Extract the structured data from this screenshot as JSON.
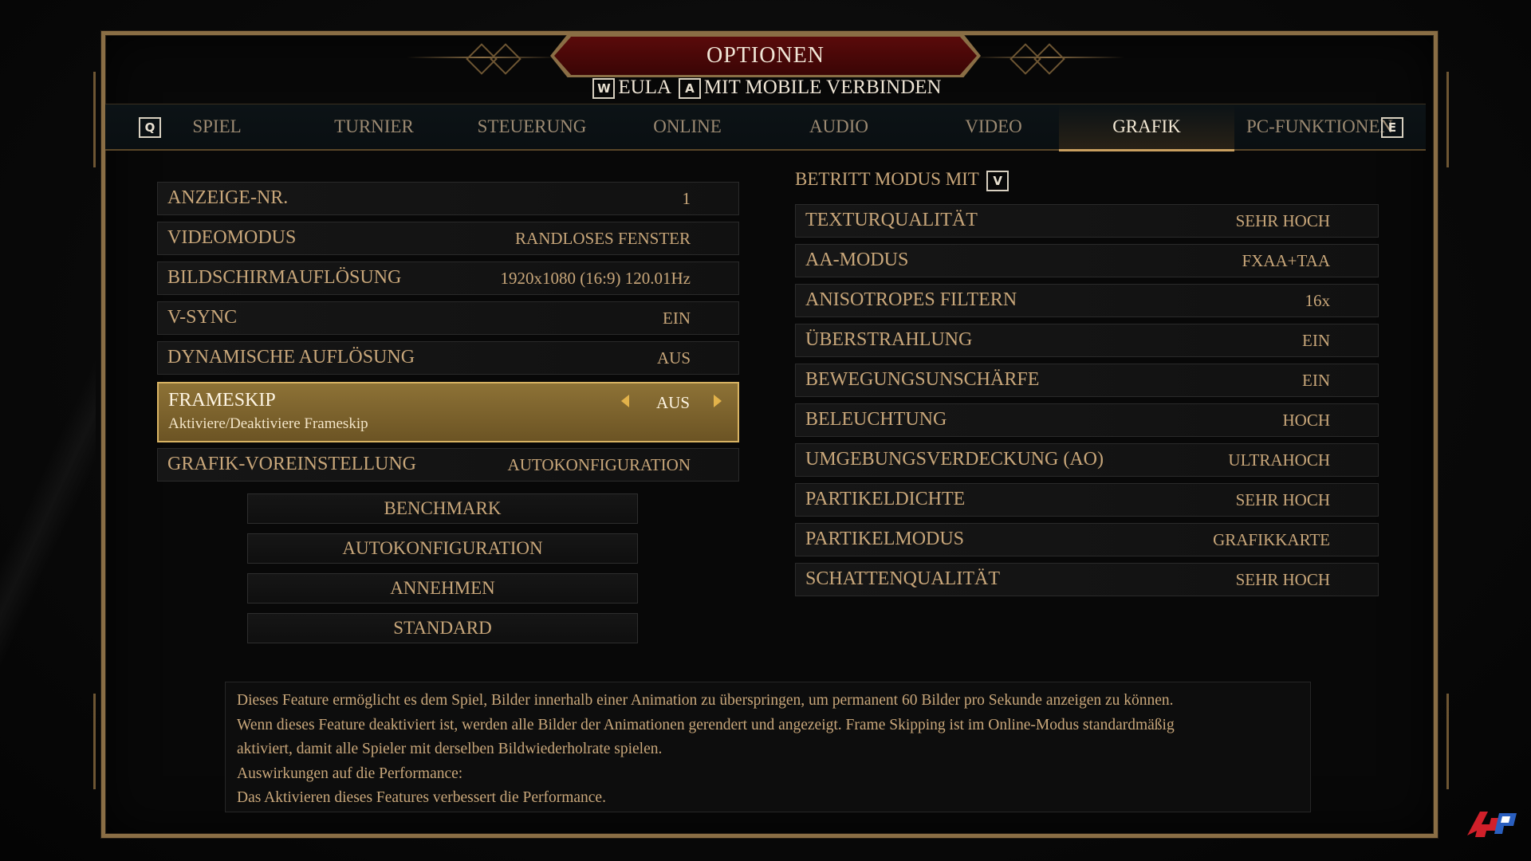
{
  "title": "OPTIONEN",
  "subheader": {
    "eula_key": "W",
    "eula_label": "EULA",
    "mobile_key": "A",
    "mobile_label": "MIT MOBILE VERBINDEN"
  },
  "tabs": {
    "prev_key": "Q",
    "next_key": "E",
    "items": [
      "SPIEL",
      "TURNIER",
      "STEUERUNG",
      "ONLINE",
      "AUDIO",
      "VIDEO",
      "GRAFIK",
      "PC-FUNKTIONEN"
    ],
    "active": "GRAFIK"
  },
  "left_settings": [
    {
      "label": "ANZEIGE-NR.",
      "value": "1"
    },
    {
      "label": "VIDEOMODUS",
      "value": "RANDLOSES FENSTER"
    },
    {
      "label": "BILDSCHIRMAUFLÖSUNG",
      "value": "1920x1080 (16:9) 120.01Hz"
    },
    {
      "label": "V-SYNC",
      "value": "EIN"
    },
    {
      "label": "DYNAMISCHE AUFLÖSUNG",
      "value": "AUS"
    },
    {
      "label": "FRAMESKIP",
      "value": "AUS",
      "description": "Aktiviere/Deaktiviere Frameskip"
    },
    {
      "label": "GRAFIK-VOREINSTELLUNG",
      "value": "AUTOKONFIGURATION"
    }
  ],
  "buttons": [
    "BENCHMARK",
    "AUTOKONFIGURATION",
    "ANNEHMEN",
    "STANDARD"
  ],
  "right_panel": {
    "enter_mode_label": "BETRITT MODUS MIT",
    "enter_mode_key": "V",
    "settings": [
      {
        "label": "TEXTURQUALITÄT",
        "value": "SEHR HOCH"
      },
      {
        "label": "AA-MODUS",
        "value": "FXAA+TAA"
      },
      {
        "label": "ANISOTROPES FILTERN",
        "value": "16x"
      },
      {
        "label": "ÜBERSTRAHLUNG",
        "value": "EIN"
      },
      {
        "label": "BEWEGUNGSUNSCHÄRFE",
        "value": "EIN"
      },
      {
        "label": "BELEUCHTUNG",
        "value": "HOCH"
      },
      {
        "label": "UMGEBUNGSVERDECKUNG (AO)",
        "value": "ULTRAHOCH"
      },
      {
        "label": "PARTIKELDICHTE",
        "value": "SEHR HOCH"
      },
      {
        "label": "PARTIKELMODUS",
        "value": "GRAFIKKARTE"
      },
      {
        "label": "SCHATTENQUALITÄT",
        "value": "SEHR HOCH"
      }
    ]
  },
  "description_lines": [
    "Dieses Feature ermöglicht es dem Spiel, Bilder innerhalb einer Animation zu überspringen, um permanent 60 Bilder pro Sekunde anzeigen zu können.",
    "Wenn dieses Feature deaktiviert ist, werden alle Bilder der Animationen gerendert und angezeigt. Frame Skipping ist im Online-Modus standardmäßig",
    "aktiviert, damit alle Spieler mit derselben Bildwiederholrate spielen.",
    "Auswirkungen auf die Performance:",
    "Das Aktivieren dieses Features verbessert die Performance."
  ],
  "colors": {
    "gold_text": "#c9a77a",
    "active_row": "#8d7236",
    "title_red": "#5a0b0b",
    "frame": "#8a6e45"
  },
  "watermark": "4P"
}
